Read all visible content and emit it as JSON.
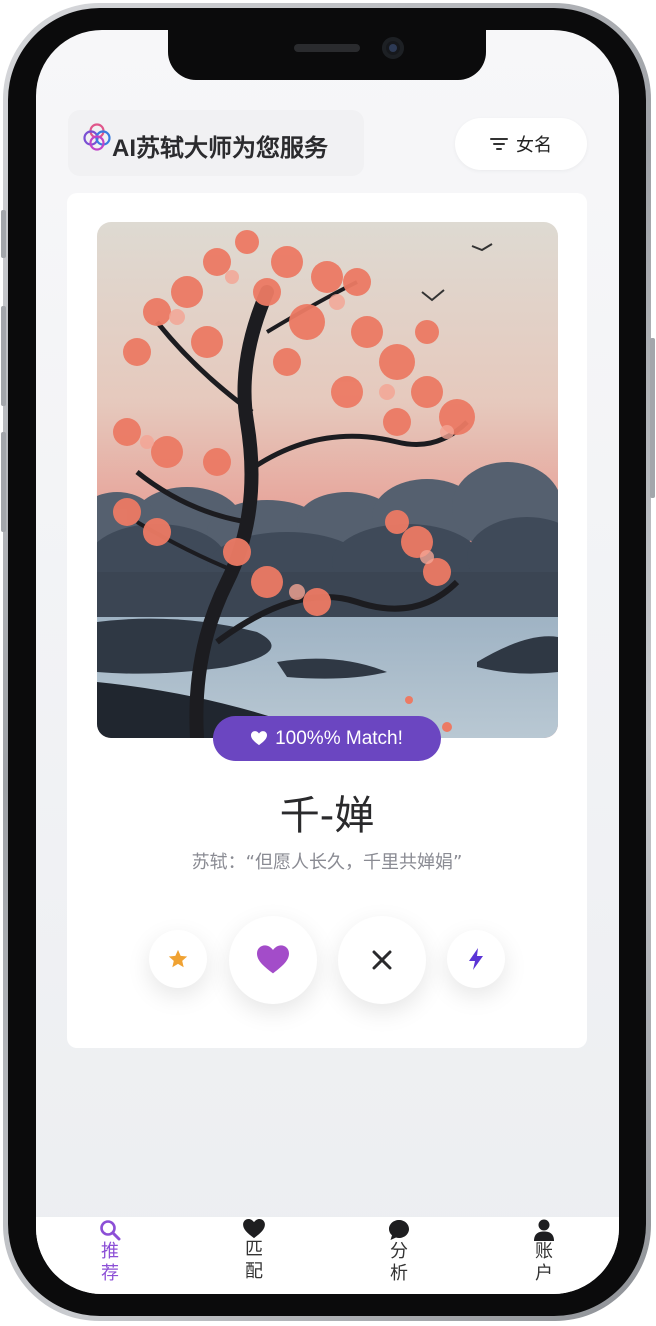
{
  "header": {
    "title": "AI苏轼大师为您服务",
    "filter_label": "女名"
  },
  "card": {
    "match_label": "100%% Match!",
    "name": "千-婵",
    "quote": "苏轼：“但愿人长久，千里共婵娟”"
  },
  "tabs": [
    {
      "label": "推荐",
      "icon": "search-icon",
      "active": true
    },
    {
      "label": "匹配",
      "icon": "heart-icon",
      "active": false
    },
    {
      "label": "分析",
      "icon": "chat-bubble-icon",
      "active": false
    },
    {
      "label": "账户",
      "icon": "user-icon",
      "active": false
    }
  ],
  "colors": {
    "accent": "#6b46c1",
    "active_tab": "#8c4fd6",
    "star": "#f0a232",
    "heart": "#a34cc9",
    "bolt": "#5b34d6"
  }
}
